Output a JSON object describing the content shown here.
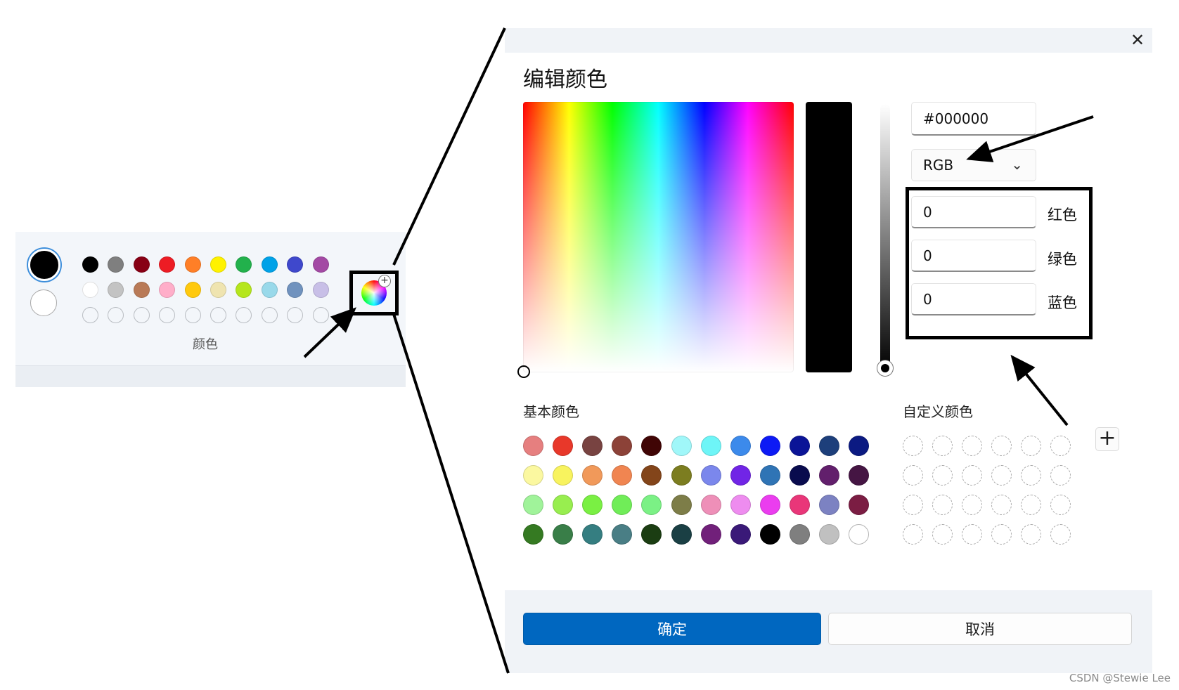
{
  "toolbar": {
    "current_colors": [
      "#000000",
      "#ffffff"
    ],
    "palette": [
      [
        "#000000",
        "#7f7f7f",
        "#880015",
        "#ed1c24",
        "#ff7f27",
        "#fff200",
        "#22b14c",
        "#00a2e8",
        "#3f48cc",
        "#a349a4"
      ],
      [
        "#ffffff",
        "#c3c3c3",
        "#b97a57",
        "#ffaec9",
        "#ffc90e",
        "#efe4b0",
        "#b5e61d",
        "#99d9ea",
        "#7092be",
        "#c8bfe7"
      ],
      [
        "",
        "",
        "",
        "",
        "",
        "",
        "",
        "",
        "",
        ""
      ]
    ],
    "label": "颜色",
    "edit_colors_icon": "color-wheel-plus-icon"
  },
  "dialog": {
    "title": "编辑颜色",
    "close_icon": "close-icon",
    "hex_value": "#000000",
    "mode": "RGB",
    "mode_chevron": "chevron-down-icon",
    "channels": [
      {
        "value": "0",
        "label": "红色"
      },
      {
        "value": "0",
        "label": "绿色"
      },
      {
        "value": "0",
        "label": "蓝色"
      }
    ],
    "basic_colors_label": "基本颜色",
    "basic_colors": [
      [
        "#e67f7f",
        "#e8382a",
        "#784341",
        "#8c4238",
        "#400505",
        "#a0f7f9",
        "#6ef5f7",
        "#3c8aeb",
        "#0d1af5",
        "#0b1497",
        "#1d3f7b",
        "#0b1a82"
      ],
      [
        "#fbf8a0",
        "#f8f35e",
        "#f1995a",
        "#f08551",
        "#83451a",
        "#7c7d20",
        "#7b87ec",
        "#7125e6",
        "#2f74b5",
        "#090b4e",
        "#621f6c",
        "#451543"
      ],
      [
        "#a0f39a",
        "#98ee4f",
        "#7af043",
        "#70ed58",
        "#7bf185",
        "#7d7d48",
        "#ee8fb8",
        "#ee8cef",
        "#eb3def",
        "#e93679",
        "#7c82c2",
        "#7b1d43"
      ],
      [
        "#357a22",
        "#397e48",
        "#357e81",
        "#497e85",
        "#1b3d12",
        "#1a3f44",
        "#71207a",
        "#3a1978",
        "#000000",
        "#7f7f7f",
        "#c0c0c0",
        "#ffffff"
      ]
    ],
    "custom_colors_label": "自定义颜色",
    "add_custom_icon": "plus-icon",
    "custom_slots": 24,
    "ok_label": "确定",
    "cancel_label": "取消"
  },
  "watermark": "CSDN @Stewie Lee"
}
